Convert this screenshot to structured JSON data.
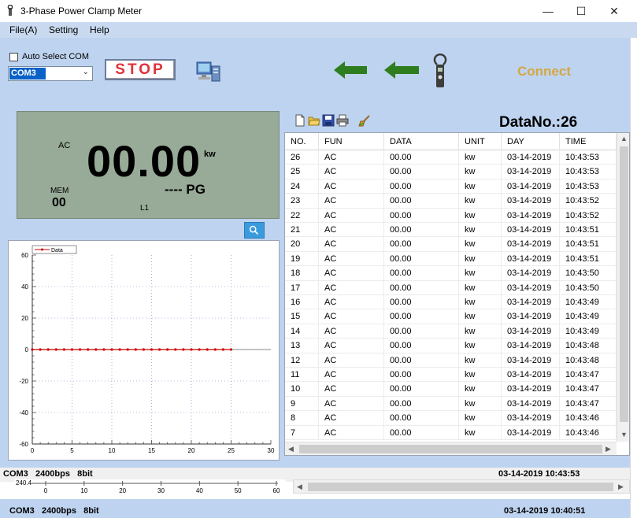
{
  "window": {
    "title": "3-Phase Power Clamp Meter",
    "minimize": "—",
    "maximize": "☐",
    "close": "✕"
  },
  "menu": [
    "File(A)",
    "Setting",
    "Help"
  ],
  "controls": {
    "auto_select_label": "Auto Select COM",
    "auto_select_checked": false,
    "com_port": "COM3",
    "stop_label": "STOP",
    "connect_label": "Connect"
  },
  "icons": {
    "app": "clamp-meter-icon",
    "computer": "computer-icon",
    "arrows": "left-arrows-icon",
    "meter": "clamp-meter-icon",
    "zoom": "zoom-icon",
    "toolbar": [
      "new-file-icon",
      "open-folder-icon",
      "save-icon",
      "print-icon",
      "clear-brush-icon"
    ]
  },
  "lcd": {
    "mode": "AC",
    "reading": "00.00",
    "unit": "kw",
    "mem_label": "MEM",
    "mem_value": "00",
    "pg": "---- PG",
    "phase": "L1"
  },
  "datano": "DataNo.:26",
  "table": {
    "columns": [
      "NO.",
      "FUN",
      "DATA",
      "UNIT",
      "DAY",
      "TIME"
    ],
    "rows": [
      [
        "26",
        "AC",
        "00.00",
        "kw",
        "03-14-2019",
        "10:43:53"
      ],
      [
        "25",
        "AC",
        "00.00",
        "kw",
        "03-14-2019",
        "10:43:53"
      ],
      [
        "24",
        "AC",
        "00.00",
        "kw",
        "03-14-2019",
        "10:43:53"
      ],
      [
        "23",
        "AC",
        "00.00",
        "kw",
        "03-14-2019",
        "10:43:52"
      ],
      [
        "22",
        "AC",
        "00.00",
        "kw",
        "03-14-2019",
        "10:43:52"
      ],
      [
        "21",
        "AC",
        "00.00",
        "kw",
        "03-14-2019",
        "10:43:51"
      ],
      [
        "20",
        "AC",
        "00.00",
        "kw",
        "03-14-2019",
        "10:43:51"
      ],
      [
        "19",
        "AC",
        "00.00",
        "kw",
        "03-14-2019",
        "10:43:51"
      ],
      [
        "18",
        "AC",
        "00.00",
        "kw",
        "03-14-2019",
        "10:43:50"
      ],
      [
        "17",
        "AC",
        "00.00",
        "kw",
        "03-14-2019",
        "10:43:50"
      ],
      [
        "16",
        "AC",
        "00.00",
        "kw",
        "03-14-2019",
        "10:43:49"
      ],
      [
        "15",
        "AC",
        "00.00",
        "kw",
        "03-14-2019",
        "10:43:49"
      ],
      [
        "14",
        "AC",
        "00.00",
        "kw",
        "03-14-2019",
        "10:43:49"
      ],
      [
        "13",
        "AC",
        "00.00",
        "kw",
        "03-14-2019",
        "10:43:48"
      ],
      [
        "12",
        "AC",
        "00.00",
        "kw",
        "03-14-2019",
        "10:43:48"
      ],
      [
        "11",
        "AC",
        "00.00",
        "kw",
        "03-14-2019",
        "10:43:47"
      ],
      [
        "10",
        "AC",
        "00.00",
        "kw",
        "03-14-2019",
        "10:43:47"
      ],
      [
        "9",
        "AC",
        "00.00",
        "kw",
        "03-14-2019",
        "10:43:47"
      ],
      [
        "8",
        "AC",
        "00.00",
        "kw",
        "03-14-2019",
        "10:43:46"
      ],
      [
        "7",
        "AC",
        "00.00",
        "kw",
        "03-14-2019",
        "10:43:46"
      ]
    ]
  },
  "chart_data": {
    "type": "line",
    "series": [
      {
        "name": "Data",
        "x": [
          0,
          1,
          2,
          3,
          4,
          5,
          6,
          7,
          8,
          9,
          10,
          11,
          12,
          13,
          14,
          15,
          16,
          17,
          18,
          19,
          20,
          21,
          22,
          23,
          24,
          25
        ],
        "values": [
          0,
          0,
          0,
          0,
          0,
          0,
          0,
          0,
          0,
          0,
          0,
          0,
          0,
          0,
          0,
          0,
          0,
          0,
          0,
          0,
          0,
          0,
          0,
          0,
          0,
          0
        ]
      }
    ],
    "xlim": [
      0,
      30
    ],
    "ylim": [
      -60,
      60
    ],
    "xticks": [
      "0",
      "5",
      "10",
      "15",
      "20",
      "25",
      "30"
    ],
    "yticks": [
      "60",
      "40",
      "20",
      "0",
      "-20",
      "-40",
      "-60"
    ],
    "grid": true,
    "legend_position": "top-left",
    "line_color": "#cc0000"
  },
  "status_top": {
    "port_info": "COM3   2400bps   8bit",
    "datetime": "03-14-2019 10:43:53"
  },
  "status_bottom": {
    "port_info": "COM3   2400bps   8bit",
    "datetime": "03-14-2019 10:40:51"
  },
  "ghost_axis": {
    "y_label": "240.4",
    "ticks": [
      "0",
      "10",
      "20",
      "30",
      "40",
      "50",
      "60"
    ]
  }
}
